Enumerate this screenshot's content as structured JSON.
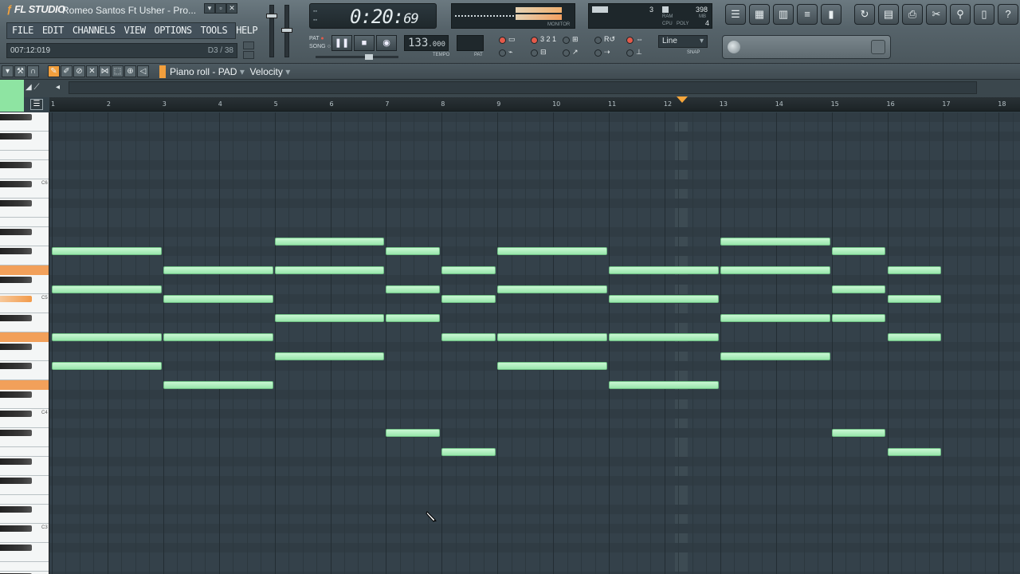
{
  "app": {
    "logo": "FL STUDIO",
    "title": "Romeo Santos Ft Usher - Pro..."
  },
  "window_buttons": [
    "▾",
    "▫",
    "✕"
  ],
  "menu": [
    "FILE",
    "EDIT",
    "CHANNELS",
    "VIEW",
    "OPTIONS",
    "TOOLS",
    "HELP"
  ],
  "hint": {
    "time": "007:12:019",
    "note": "D3 / 38"
  },
  "transport": {
    "pat_label": "PAT",
    "song_label": "SONG",
    "time_main": "0:20:",
    "time_ms": "69",
    "tempo_int": "133",
    "tempo_dec": ".000",
    "tempo_label": "TEMPO",
    "pat_label2": "PAT"
  },
  "monitor": {
    "label": "MONITOR"
  },
  "cpu": {
    "count": "3",
    "mem": "398",
    "cpu_label": "CPU",
    "poly_label": "POLY",
    "ram_label": "RAM",
    "mb_label": "MB",
    "poly": "4"
  },
  "snap": {
    "value": "Line",
    "label": "SNAP"
  },
  "toolbar": {
    "title": "Piano roll - PAD",
    "velocity": "Velocity"
  },
  "ruler": [
    "1",
    "2",
    "3",
    "4",
    "5",
    "6",
    "7",
    "8",
    "9",
    "10",
    "11",
    "12",
    "13",
    "14",
    "15",
    "16",
    "17",
    "18"
  ],
  "key_labels": [
    "C6",
    "C5",
    "C4",
    "C3"
  ],
  "notes": [
    {
      "bar": 1,
      "len": 2,
      "row": 14
    },
    {
      "bar": 1,
      "len": 2,
      "row": 18
    },
    {
      "bar": 1,
      "len": 2,
      "row": 23
    },
    {
      "bar": 1,
      "len": 2,
      "row": 26
    },
    {
      "bar": 3,
      "len": 2,
      "row": 16
    },
    {
      "bar": 3,
      "len": 2,
      "row": 19
    },
    {
      "bar": 3,
      "len": 2,
      "row": 23
    },
    {
      "bar": 3,
      "len": 2,
      "row": 28
    },
    {
      "bar": 5,
      "len": 2,
      "row": 13
    },
    {
      "bar": 5,
      "len": 2,
      "row": 16
    },
    {
      "bar": 5,
      "len": 2,
      "row": 21
    },
    {
      "bar": 5,
      "len": 2,
      "row": 25
    },
    {
      "bar": 7,
      "len": 1,
      "row": 14
    },
    {
      "bar": 7,
      "len": 1,
      "row": 18
    },
    {
      "bar": 7,
      "len": 1,
      "row": 21
    },
    {
      "bar": 7,
      "len": 1,
      "row": 33
    },
    {
      "bar": 8,
      "len": 1,
      "row": 16
    },
    {
      "bar": 8,
      "len": 1,
      "row": 19
    },
    {
      "bar": 8,
      "len": 1,
      "row": 23
    },
    {
      "bar": 8,
      "len": 1,
      "row": 35
    },
    {
      "bar": 9,
      "len": 2,
      "row": 14
    },
    {
      "bar": 9,
      "len": 2,
      "row": 18
    },
    {
      "bar": 9,
      "len": 2,
      "row": 23
    },
    {
      "bar": 9,
      "len": 2,
      "row": 26
    },
    {
      "bar": 11,
      "len": 2,
      "row": 16
    },
    {
      "bar": 11,
      "len": 2,
      "row": 19
    },
    {
      "bar": 11,
      "len": 2,
      "row": 23
    },
    {
      "bar": 11,
      "len": 2,
      "row": 28
    },
    {
      "bar": 13,
      "len": 2,
      "row": 13
    },
    {
      "bar": 13,
      "len": 2,
      "row": 16
    },
    {
      "bar": 13,
      "len": 2,
      "row": 21
    },
    {
      "bar": 13,
      "len": 2,
      "row": 25
    },
    {
      "bar": 15,
      "len": 1,
      "row": 14
    },
    {
      "bar": 15,
      "len": 1,
      "row": 18
    },
    {
      "bar": 15,
      "len": 1,
      "row": 21
    },
    {
      "bar": 15,
      "len": 1,
      "row": 33
    },
    {
      "bar": 16,
      "len": 1,
      "row": 16
    },
    {
      "bar": 16,
      "len": 1,
      "row": 19
    },
    {
      "bar": 16,
      "len": 1,
      "row": 23
    },
    {
      "bar": 16,
      "len": 1,
      "row": 35
    }
  ],
  "playhead_bar": 12.3
}
